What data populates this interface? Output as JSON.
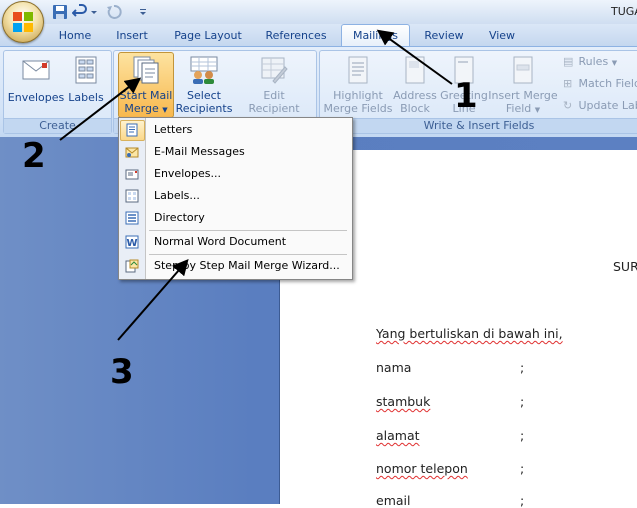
{
  "window": {
    "title": "TUGA"
  },
  "tabs": [
    "Home",
    "Insert",
    "Page Layout",
    "References",
    "Mailings",
    "Review",
    "View"
  ],
  "ribbon": {
    "create": {
      "label": "Create",
      "envelopes": "Envelopes",
      "labels": "Labels"
    },
    "start": {
      "start_mail_merge_1": "Start Mail",
      "start_mail_merge_2": "Merge",
      "select_recipients_1": "Select",
      "select_recipients_2": "Recipients",
      "edit_list_1": "Edit",
      "edit_list_2": "Recipient List"
    },
    "fields": {
      "label": "Write & Insert Fields",
      "highlight_1": "Highlight",
      "highlight_2": "Merge Fields",
      "address_1": "Address",
      "address_2": "Block",
      "greeting_1": "Greeting",
      "greeting_2": "Line",
      "insert_1": "Insert Merge",
      "insert_2": "Field",
      "rules": "Rules",
      "match": "Match Fields",
      "update": "Update Labels"
    }
  },
  "menu": {
    "items": [
      "Letters",
      "E-Mail Messages",
      "Envelopes...",
      "Labels...",
      "Directory",
      "Normal Word Document",
      "Step by Step Mail Merge Wizard..."
    ]
  },
  "annotations": {
    "one": "1",
    "two": "2",
    "three": "3"
  },
  "document": {
    "heading": "SUR",
    "intro": "Yang bertuliskan di bawah ini,",
    "fields": [
      {
        "label": "nama",
        "sep": ";"
      },
      {
        "label": "stambuk",
        "sep": ";"
      },
      {
        "label": "alamat",
        "sep": ";"
      },
      {
        "label": "nomor telepon",
        "sep": ";"
      },
      {
        "label": "email",
        "sep": ";"
      }
    ]
  },
  "colors": {
    "accent": "#15428b",
    "ribbon": "#d3e3f7",
    "docbg": "#5a7ec0",
    "highlight": "#fbd88a"
  }
}
